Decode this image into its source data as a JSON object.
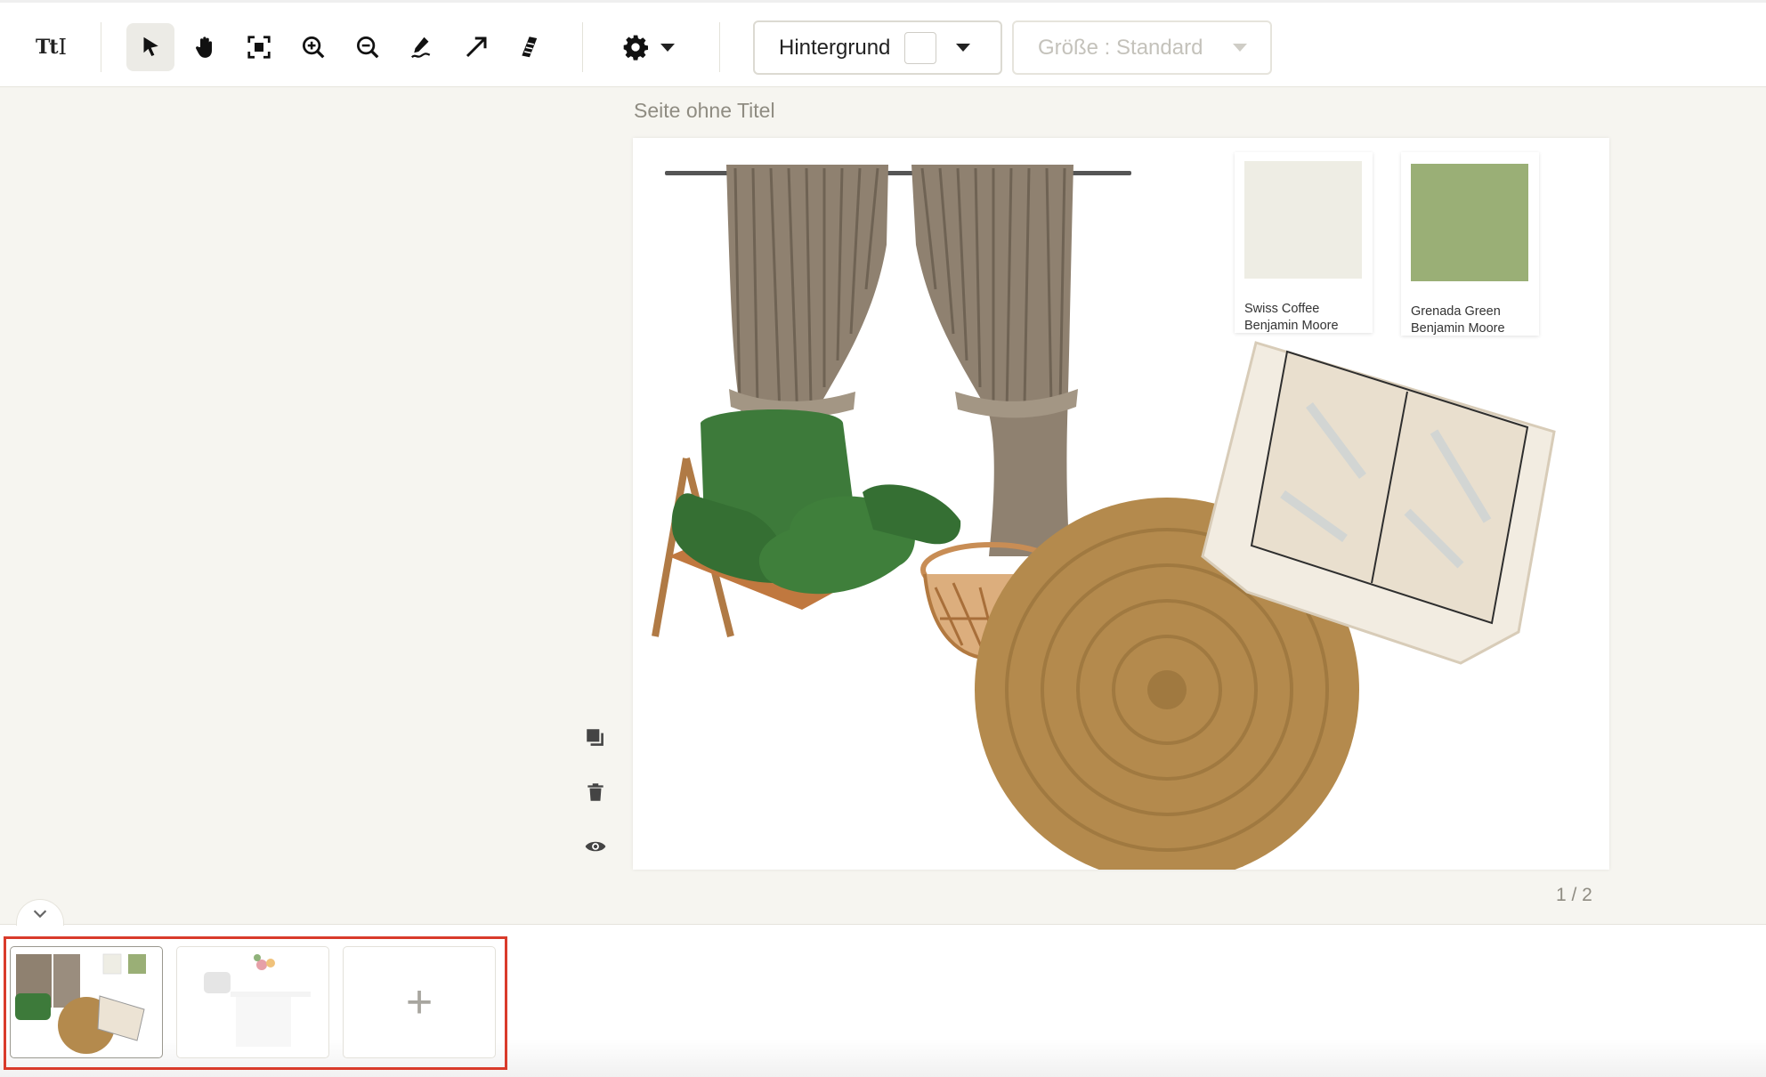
{
  "toolbar": {
    "tools": [
      {
        "name": "text-tool",
        "label": "Tt"
      },
      {
        "name": "select-tool",
        "icon": "cursor-arrow-icon",
        "active": true
      },
      {
        "name": "pan-tool",
        "icon": "hand-icon"
      },
      {
        "name": "fit-screen-tool",
        "icon": "fit-screen-icon"
      },
      {
        "name": "zoom-in-tool",
        "icon": "zoom-in-icon"
      },
      {
        "name": "zoom-out-tool",
        "icon": "zoom-out-icon"
      },
      {
        "name": "draw-tool",
        "icon": "pen-icon"
      },
      {
        "name": "arrow-tool",
        "icon": "arrow-icon"
      },
      {
        "name": "eraser-tool",
        "icon": "eraser-icon"
      }
    ],
    "settings_icon": "gear-icon",
    "background_dropdown": {
      "label": "Hintergrund",
      "swatch_color": "#ffffff"
    },
    "size_dropdown": {
      "label": "Größe : Standard",
      "disabled": true
    }
  },
  "page": {
    "title": "Seite ohne Titel",
    "counter": "1 / 2",
    "swatches": [
      {
        "line1": "Swiss Coffee",
        "line2": "Benjamin Moore",
        "color": "#eeede4"
      },
      {
        "line1": "Grenada Green",
        "line2": "Benjamin Moore",
        "color": "#9aaf76"
      }
    ],
    "items": [
      "curtains",
      "green-lounge-chair",
      "rattan-basket",
      "round-jute-rug",
      "wooden-cabinet"
    ]
  },
  "side_tools": [
    "layer-icon",
    "trash-icon",
    "eye-icon"
  ],
  "thumbnails": {
    "pages": [
      {
        "index": 1,
        "selected": true
      },
      {
        "index": 2,
        "selected": false
      }
    ],
    "add_label": "+"
  },
  "colors": {
    "accent_outline": "#d93b2b",
    "canvas_bg": "#f6f5f0"
  }
}
